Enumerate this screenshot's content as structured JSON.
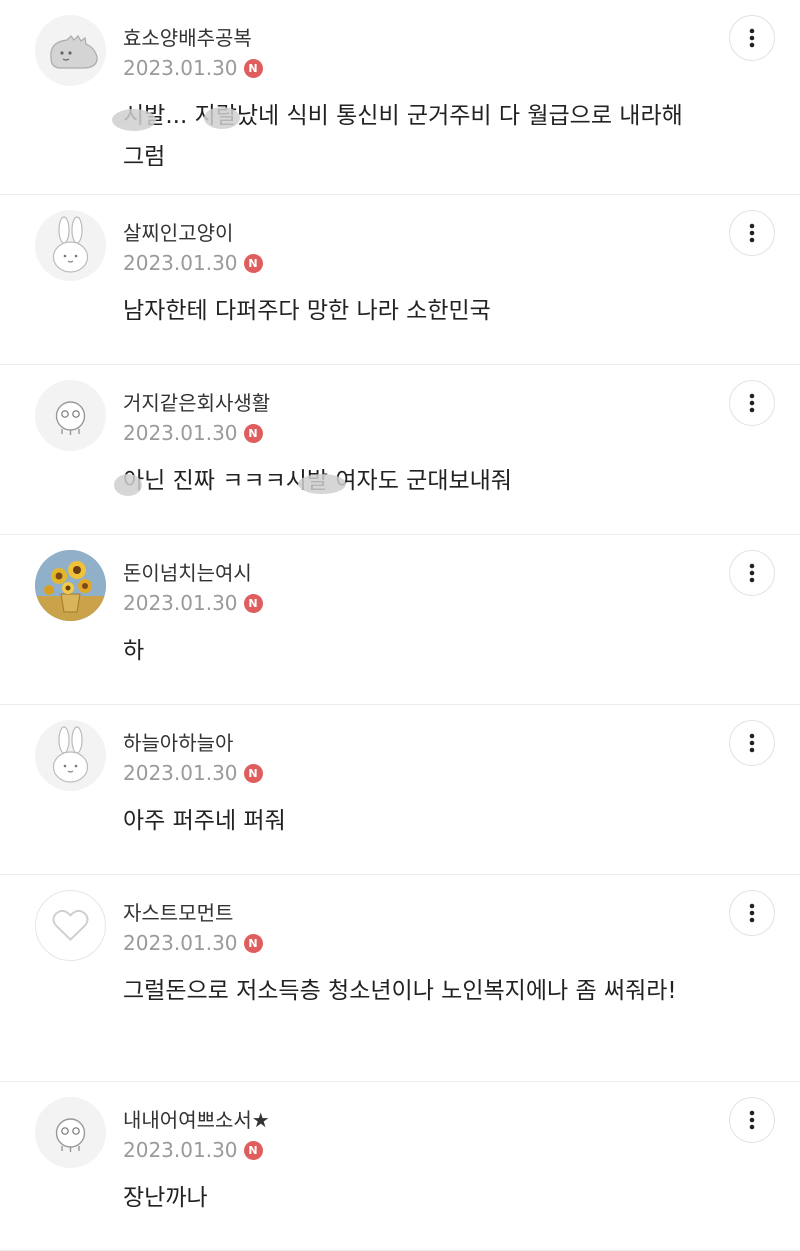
{
  "comments": [
    {
      "avatar": "dino-avatar-icon",
      "nickname": "효소양배추공복",
      "date": "2023.01.30",
      "badge": "N",
      "text": "시발... 지랄났네 식비 통신비 군거주비 다 월급으로 내라해 그럼"
    },
    {
      "avatar": "rabbit-avatar-icon",
      "nickname": "살찌인고양이",
      "date": "2023.01.30",
      "badge": "N",
      "text": "남자한테 다퍼주다 망한 나라 소한민국"
    },
    {
      "avatar": "character-avatar-icon",
      "nickname": "거지같은회사생활",
      "date": "2023.01.30",
      "badge": "N",
      "text": "아닌 진짜 ㅋㅋㅋ시발 여자도 군대보내줘"
    },
    {
      "avatar": "sunflower-photo-avatar",
      "nickname": "돈이넘치는여시",
      "date": "2023.01.30",
      "badge": "N",
      "text": "하"
    },
    {
      "avatar": "rabbit-avatar-icon",
      "nickname": "하늘아하늘아",
      "date": "2023.01.30",
      "badge": "N",
      "text": "아주 퍼주네 퍼줘"
    },
    {
      "avatar": "heart-avatar-icon",
      "nickname": "자스트모먼트",
      "date": "2023.01.30",
      "badge": "N",
      "text": "그럴돈으로 저소득층 청소년이나 노인복지에나 좀 써줘라!"
    },
    {
      "avatar": "character-avatar-icon",
      "nickname": "내내어여쁘소서★",
      "date": "2023.01.30",
      "badge": "N",
      "text": "장난까나"
    }
  ],
  "more_icon": "more-vertical-icon"
}
